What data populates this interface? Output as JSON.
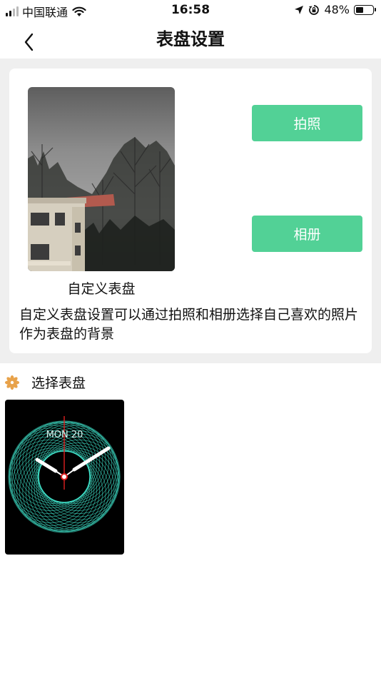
{
  "status_bar": {
    "carrier": "中国联通",
    "time": "16:58",
    "battery": "48%",
    "battery_level": 0.48,
    "icons": [
      "signal-icon",
      "wifi-icon",
      "location-icon",
      "rotation-lock-icon",
      "battery-icon"
    ]
  },
  "nav": {
    "title": "表盘设置",
    "back_icon": "chevron-left-icon"
  },
  "custom": {
    "preview_label": "自定义表盘",
    "camera_button": "拍照",
    "album_button": "相册",
    "description": "自定义表盘设置可以通过拍照和相册选择自己喜欢的照片作为表盘的背景"
  },
  "select_section": {
    "title": "选择表盘",
    "icon": "flower-icon",
    "icon_color": "#e8a24a"
  },
  "watch_face": {
    "date": "MON 20",
    "ring_color": "#3fe0c8"
  },
  "colors": {
    "accent": "#52d196",
    "section_background": "#efefef"
  }
}
